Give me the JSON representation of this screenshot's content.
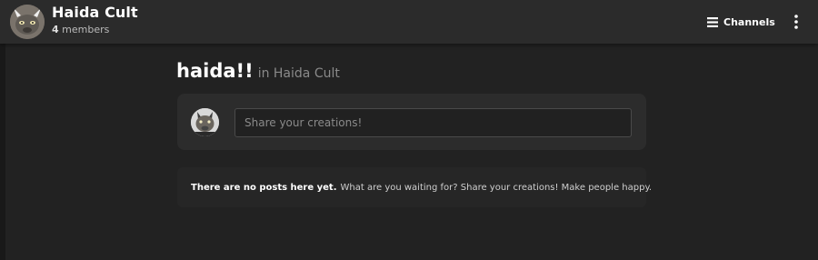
{
  "header": {
    "group_title": "Haida Cult",
    "member_count": "4",
    "member_label": "members",
    "channels_label": "Channels",
    "avatar_icon": "group-avatar-icon",
    "channels_icon": "hamburger-menu-icon",
    "more_icon": "kebab-menu-icon"
  },
  "main": {
    "channel_name": "haida!!",
    "in_group": "in Haida Cult"
  },
  "composer": {
    "placeholder": "Share your creations!",
    "value": ""
  },
  "empty_state": {
    "bold": "There are no posts here yet.",
    "text": "What are you waiting for? Share your creations! Make people happy."
  },
  "colors": {
    "background": "#222222",
    "header": "#2b2b2b",
    "card": "#2c2c2c",
    "input_border": "#4a4a4a",
    "muted_text": "#8a8a8a"
  }
}
